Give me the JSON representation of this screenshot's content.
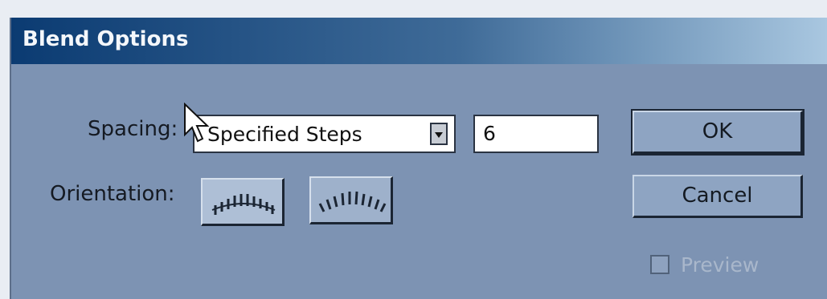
{
  "dialog": {
    "title": "Blend Options"
  },
  "spacing": {
    "label": "Spacing:",
    "selected": "Specified Steps",
    "steps_value": "6"
  },
  "orientation": {
    "label": "Orientation:",
    "options": [
      "align-to-page-icon",
      "align-to-path-icon"
    ]
  },
  "buttons": {
    "ok": "OK",
    "cancel": "Cancel"
  },
  "preview": {
    "label": "Preview",
    "checked": false,
    "enabled": false
  },
  "colors": {
    "dialog_bg": "#7d93b3",
    "title_start": "#0b3b72",
    "title_end": "#a9c7e0"
  }
}
